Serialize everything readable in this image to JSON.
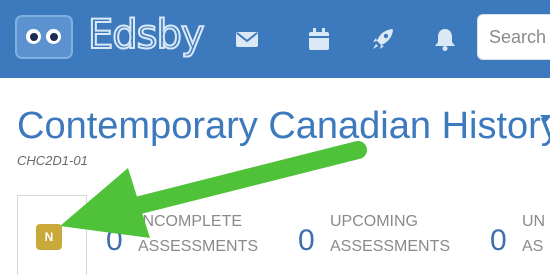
{
  "app": {
    "brand": "Edsby",
    "search": {
      "placeholder": "Search"
    },
    "nav_icons": [
      "mail-icon",
      "calendar-icon",
      "rocket-icon",
      "bell-icon"
    ]
  },
  "course": {
    "title": "Contemporary Canadian History",
    "code": "CHC2D1-01"
  },
  "stats": {
    "badge": "N",
    "items": [
      {
        "count": "0",
        "line1": "INCOMPLETE",
        "line2": "ASSESSMENTS"
      },
      {
        "count": "0",
        "line1": "UPCOMING",
        "line2": "ASSESSMENTS"
      },
      {
        "count": "0",
        "line1": "UN",
        "line2": "AS"
      }
    ]
  },
  "colors": {
    "topbar": "#3d79bd",
    "accent": "#3d79bd",
    "badge": "#c9a93a",
    "annotation_arrow": "#4fc23a"
  }
}
